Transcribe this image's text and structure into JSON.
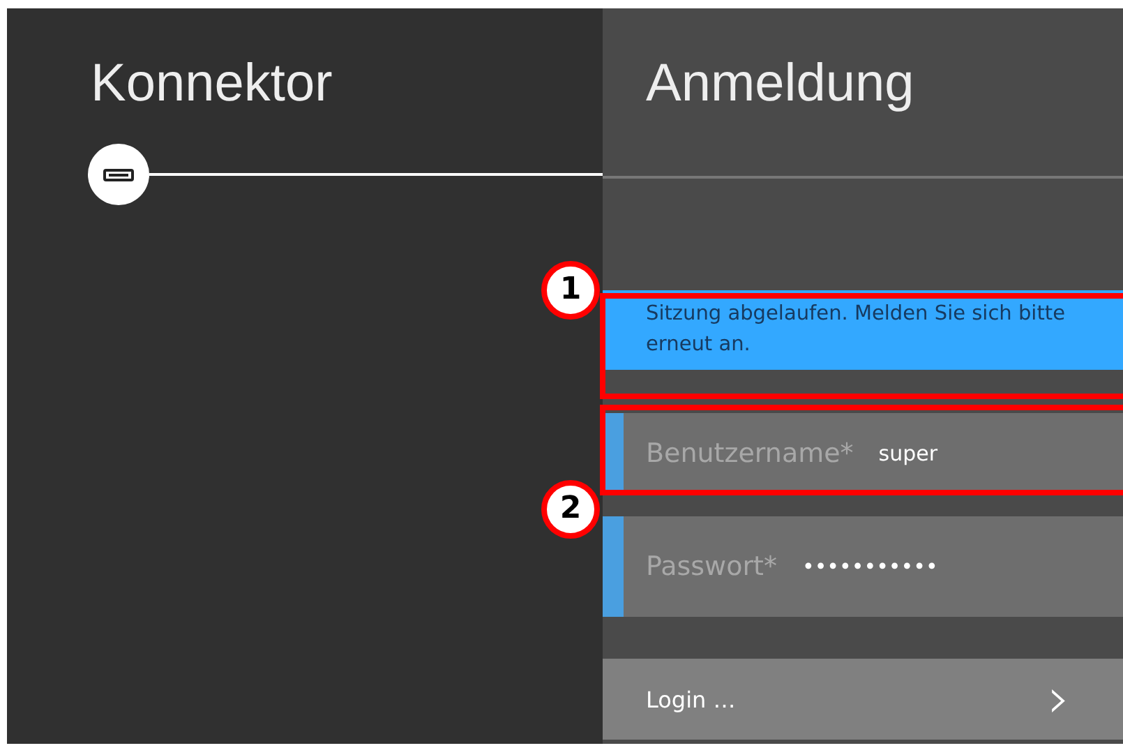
{
  "panels": [
    {
      "title": "Konnektor"
    },
    {
      "title": "Anmeldung"
    }
  ],
  "message": "Sitzung abgelaufen. Melden Sie sich bitte erneut an.",
  "fields": [
    {
      "label": "Benutzername*",
      "value": "super"
    },
    {
      "label": "Passwort*",
      "value": "•••••••••••"
    }
  ],
  "login_button": {
    "label": "Login …",
    "arrow": "›"
  },
  "callouts": [
    {
      "number": "1"
    },
    {
      "number": "2"
    }
  ]
}
